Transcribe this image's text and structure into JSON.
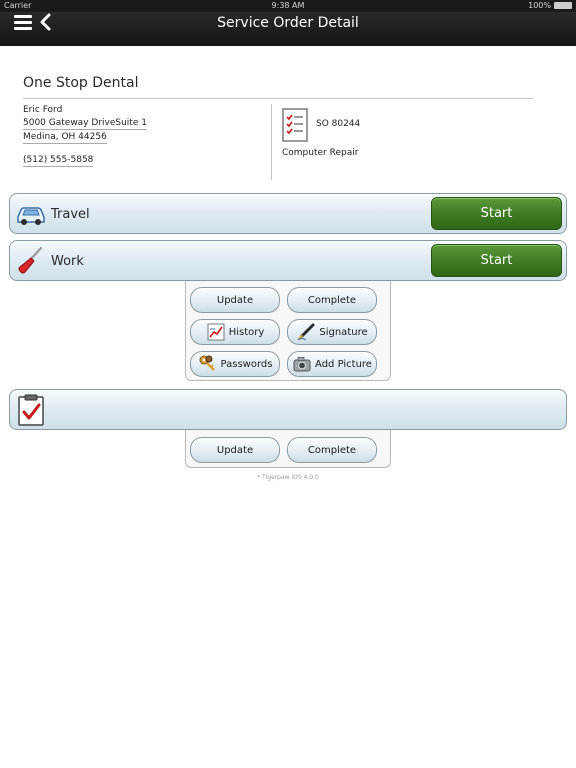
{
  "status_bar": {
    "carrier": "Carrier",
    "time": "9:38 AM",
    "battery": "100%"
  },
  "nav": {
    "title": "Service Order Detail"
  },
  "customer": {
    "company": "One Stop Dental",
    "contact": "Eric Ford",
    "address_line1": "5000 Gateway DriveSuite 1",
    "address_line2": "Medina, OH 44256",
    "phone": "(512) 555-5858"
  },
  "order": {
    "number": "SO 80244",
    "type": "Computer Repair"
  },
  "sections": {
    "travel": {
      "label": "Travel",
      "start_label": "Start"
    },
    "work": {
      "label": "Work",
      "start_label": "Start"
    },
    "checklist": {
      "label": ""
    }
  },
  "work_panel": {
    "update_label": "Update",
    "complete_label": "Complete",
    "history_label": "History",
    "signature_label": "Signature",
    "passwords_label": "Passwords",
    "add_picture_label": "Add Picture"
  },
  "checklist_panel": {
    "update_label": "Update",
    "complete_label": "Complete"
  },
  "footer": {
    "version": "* Tigerpaw iOS 4.0.0"
  },
  "colors": {
    "start_green": "#3f7d24",
    "bar_blue": "#dfeaf1",
    "navbar": "#1f1f1f"
  }
}
